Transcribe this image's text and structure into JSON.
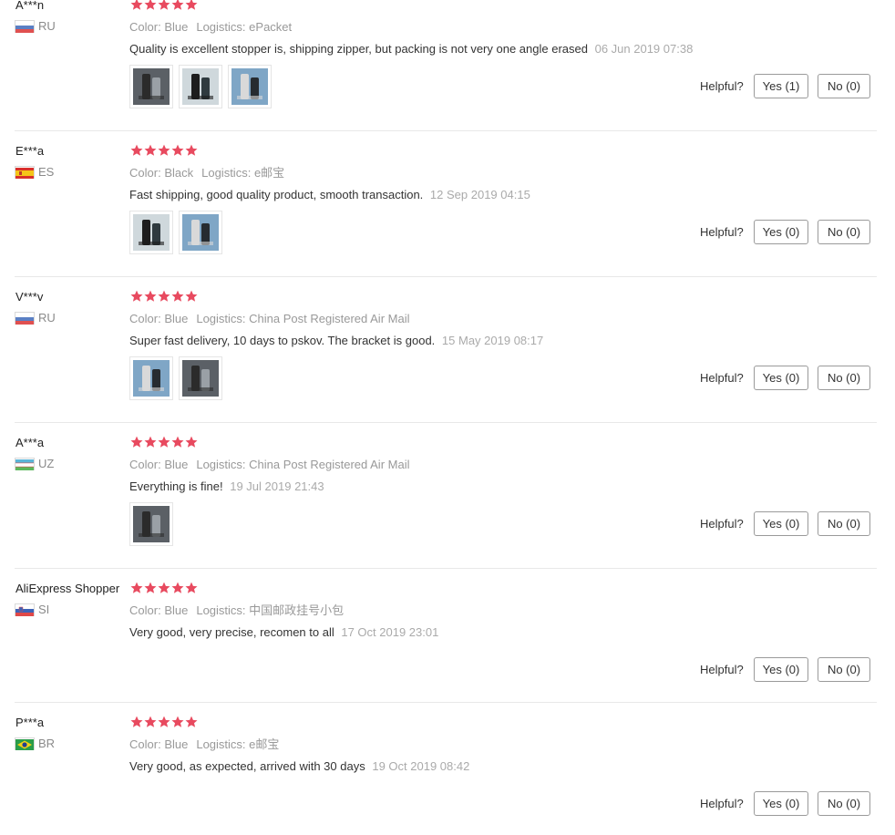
{
  "labels": {
    "color": "Color:",
    "logistics": "Logistics:",
    "helpful": "Helpful?"
  },
  "colors": {
    "star": "#e84a5f",
    "date": "#aaaaaa",
    "meta": "#999999"
  },
  "reviews": [
    {
      "user": "A***n",
      "country": "RU",
      "flag": "russia-flag-icon",
      "rating": 5,
      "color": "Blue",
      "logistics": "ePacket",
      "text": "Quality is excellent stopper is, shipping zipper, but packing is not very one angle erased",
      "date": "06 Jun 2019 07:38",
      "photos": [
        "product-photo",
        "product-photo",
        "product-photo"
      ],
      "yes": "Yes (1)",
      "no": "No (0)"
    },
    {
      "user": "E***a",
      "country": "ES",
      "flag": "spain-flag-icon",
      "rating": 5,
      "color": "Black",
      "logistics": "e邮宝",
      "text": "Fast shipping, good quality product, smooth transaction.",
      "date": "12 Sep 2019 04:15",
      "photos": [
        "product-photo",
        "product-photo"
      ],
      "yes": "Yes (0)",
      "no": "No (0)"
    },
    {
      "user": "V***v",
      "country": "RU",
      "flag": "russia-flag-icon",
      "rating": 5,
      "color": "Blue",
      "logistics": "China Post Registered Air Mail",
      "text": "Super fast delivery, 10 days to pskov. The bracket is good.",
      "date": "15 May 2019 08:17",
      "photos": [
        "product-photo",
        "product-photo"
      ],
      "yes": "Yes (0)",
      "no": "No (0)"
    },
    {
      "user": "A***a",
      "country": "UZ",
      "flag": "uzbekistan-flag-icon",
      "rating": 5,
      "color": "Blue",
      "logistics": "China Post Registered Air Mail",
      "text": "Everything is fine!",
      "date": "19 Jul 2019 21:43",
      "photos": [
        "product-photo"
      ],
      "yes": "Yes (0)",
      "no": "No (0)"
    },
    {
      "user": "AliExpress Shopper",
      "country": "SI",
      "flag": "slovenia-flag-icon",
      "rating": 5,
      "color": "Blue",
      "logistics": "中国邮政挂号小包",
      "text": "Very good, very precise, recomen to all",
      "date": "17 Oct 2019 23:01",
      "photos": [],
      "yes": "Yes (0)",
      "no": "No (0)"
    },
    {
      "user": "P***a",
      "country": "BR",
      "flag": "brazil-flag-icon",
      "rating": 5,
      "color": "Blue",
      "logistics": "e邮宝",
      "text": "Very good, as expected, arrived with 30 days",
      "date": "19 Oct 2019 08:42",
      "photos": [],
      "yes": "Yes (0)",
      "no": "No (0)"
    }
  ]
}
